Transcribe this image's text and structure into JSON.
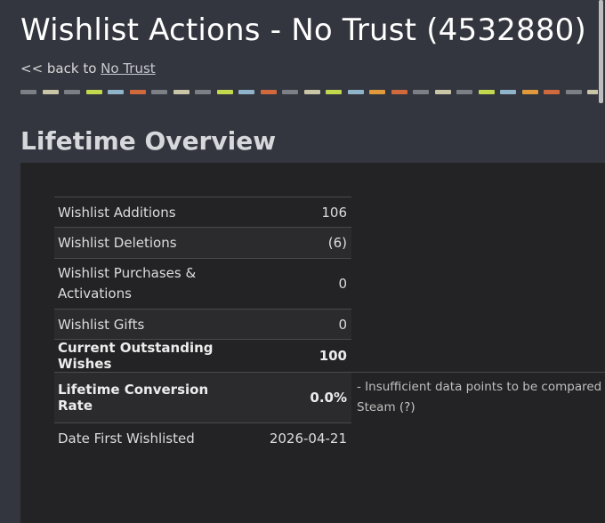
{
  "header": {
    "title": "Wishlist Actions - No Trust (4532880)",
    "back_prefix": "<< back to ",
    "back_link": "No Trust"
  },
  "divider_colors": [
    "#7d7f86",
    "#c9c6a8",
    "#7d7f86",
    "#c3d94d",
    "#8fb3c8",
    "#d0693b",
    "#7d7f86",
    "#c9c6a8",
    "#7d7f86",
    "#c3d94d",
    "#8fb3c8",
    "#d0693b",
    "#7d7f86",
    "#c9c6a8",
    "#c3d94d",
    "#8fb3c8",
    "#e09a3b",
    "#d0693b",
    "#7d7f86",
    "#c9c6a8",
    "#7d7f86",
    "#c3d94d",
    "#8fb3c8",
    "#e09a3b",
    "#d0693b",
    "#7d7f86",
    "#c9c6a8"
  ],
  "section": {
    "heading": "Lifetime Overview"
  },
  "stats": [
    {
      "label": "Wishlist Additions",
      "value": "106",
      "bold": false
    },
    {
      "label": "Wishlist Deletions",
      "value": "(6)",
      "bold": false
    },
    {
      "label": "Wishlist Purchases & Activations",
      "value": "0",
      "bold": false
    },
    {
      "label": "Wishlist Gifts",
      "value": "0",
      "bold": false
    },
    {
      "label": "Current Outstanding Wishes",
      "value": "100",
      "bold": true
    },
    {
      "label": "Lifetime Conversion Rate",
      "value": "0.0%",
      "bold": true
    },
    {
      "label": "Date First Wishlisted",
      "value": "2026-04-21",
      "bold": false
    }
  ],
  "conversion_note": {
    "text": "- Insufficient data points to be compared",
    "text2_prefix": "Steam ",
    "help": "(?)"
  }
}
